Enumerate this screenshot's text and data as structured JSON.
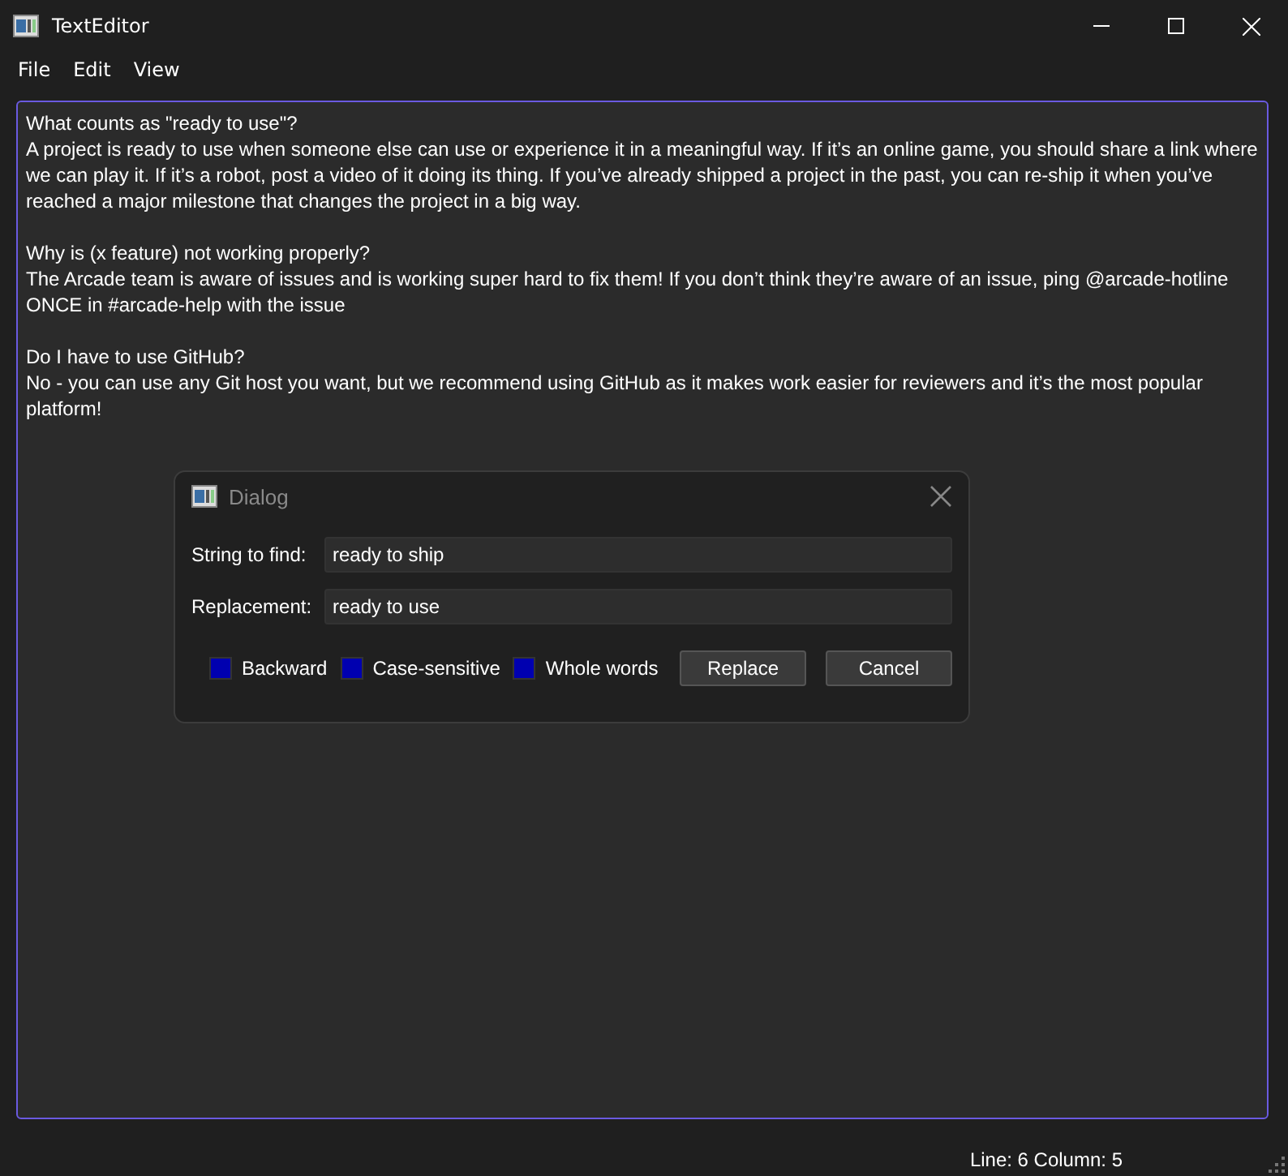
{
  "window": {
    "title": "TextEditor"
  },
  "menu": [
    "File",
    "Edit",
    "View"
  ],
  "editor": {
    "paragraphs": [
      {
        "lines": [
          "What counts as \"ready to use\"?",
          "A project is ready to use when someone else can use or experience it in a meaningful way. If it’s an online game, you should share a link where we can play it. If it’s a robot, post a video of it doing its thing. If you’ve already shipped a project in the past, you can re-ship it when you’ve reached a major milestone that changes the project in a big way."
        ]
      },
      {
        "lines": [
          "Why is (x feature) not working properly?",
          "The Arcade team is aware of issues and is working super hard to fix them! If you don’t think they’re aware of an issue, ping @arcade-hotline ONCE in #arcade-help with the issue"
        ]
      },
      {
        "lines": [
          "Do I have to use GitHub?",
          "No - you can use any Git host you want, but we recommend using GitHub as it makes work easier for reviewers and it’s the most popular platform!"
        ]
      }
    ]
  },
  "dialog": {
    "title": "Dialog",
    "fields": [
      {
        "label": "String to find:",
        "value": "ready to ship"
      },
      {
        "label": "Replacement:",
        "value": "ready to use"
      }
    ],
    "options": [
      {
        "label": "Backward",
        "checked": false
      },
      {
        "label": "Case-sensitive",
        "checked": false
      },
      {
        "label": "Whole words",
        "checked": false
      }
    ],
    "buttons": [
      "Replace",
      "Cancel"
    ]
  },
  "status_bar": "Line: 6 Column: 5"
}
